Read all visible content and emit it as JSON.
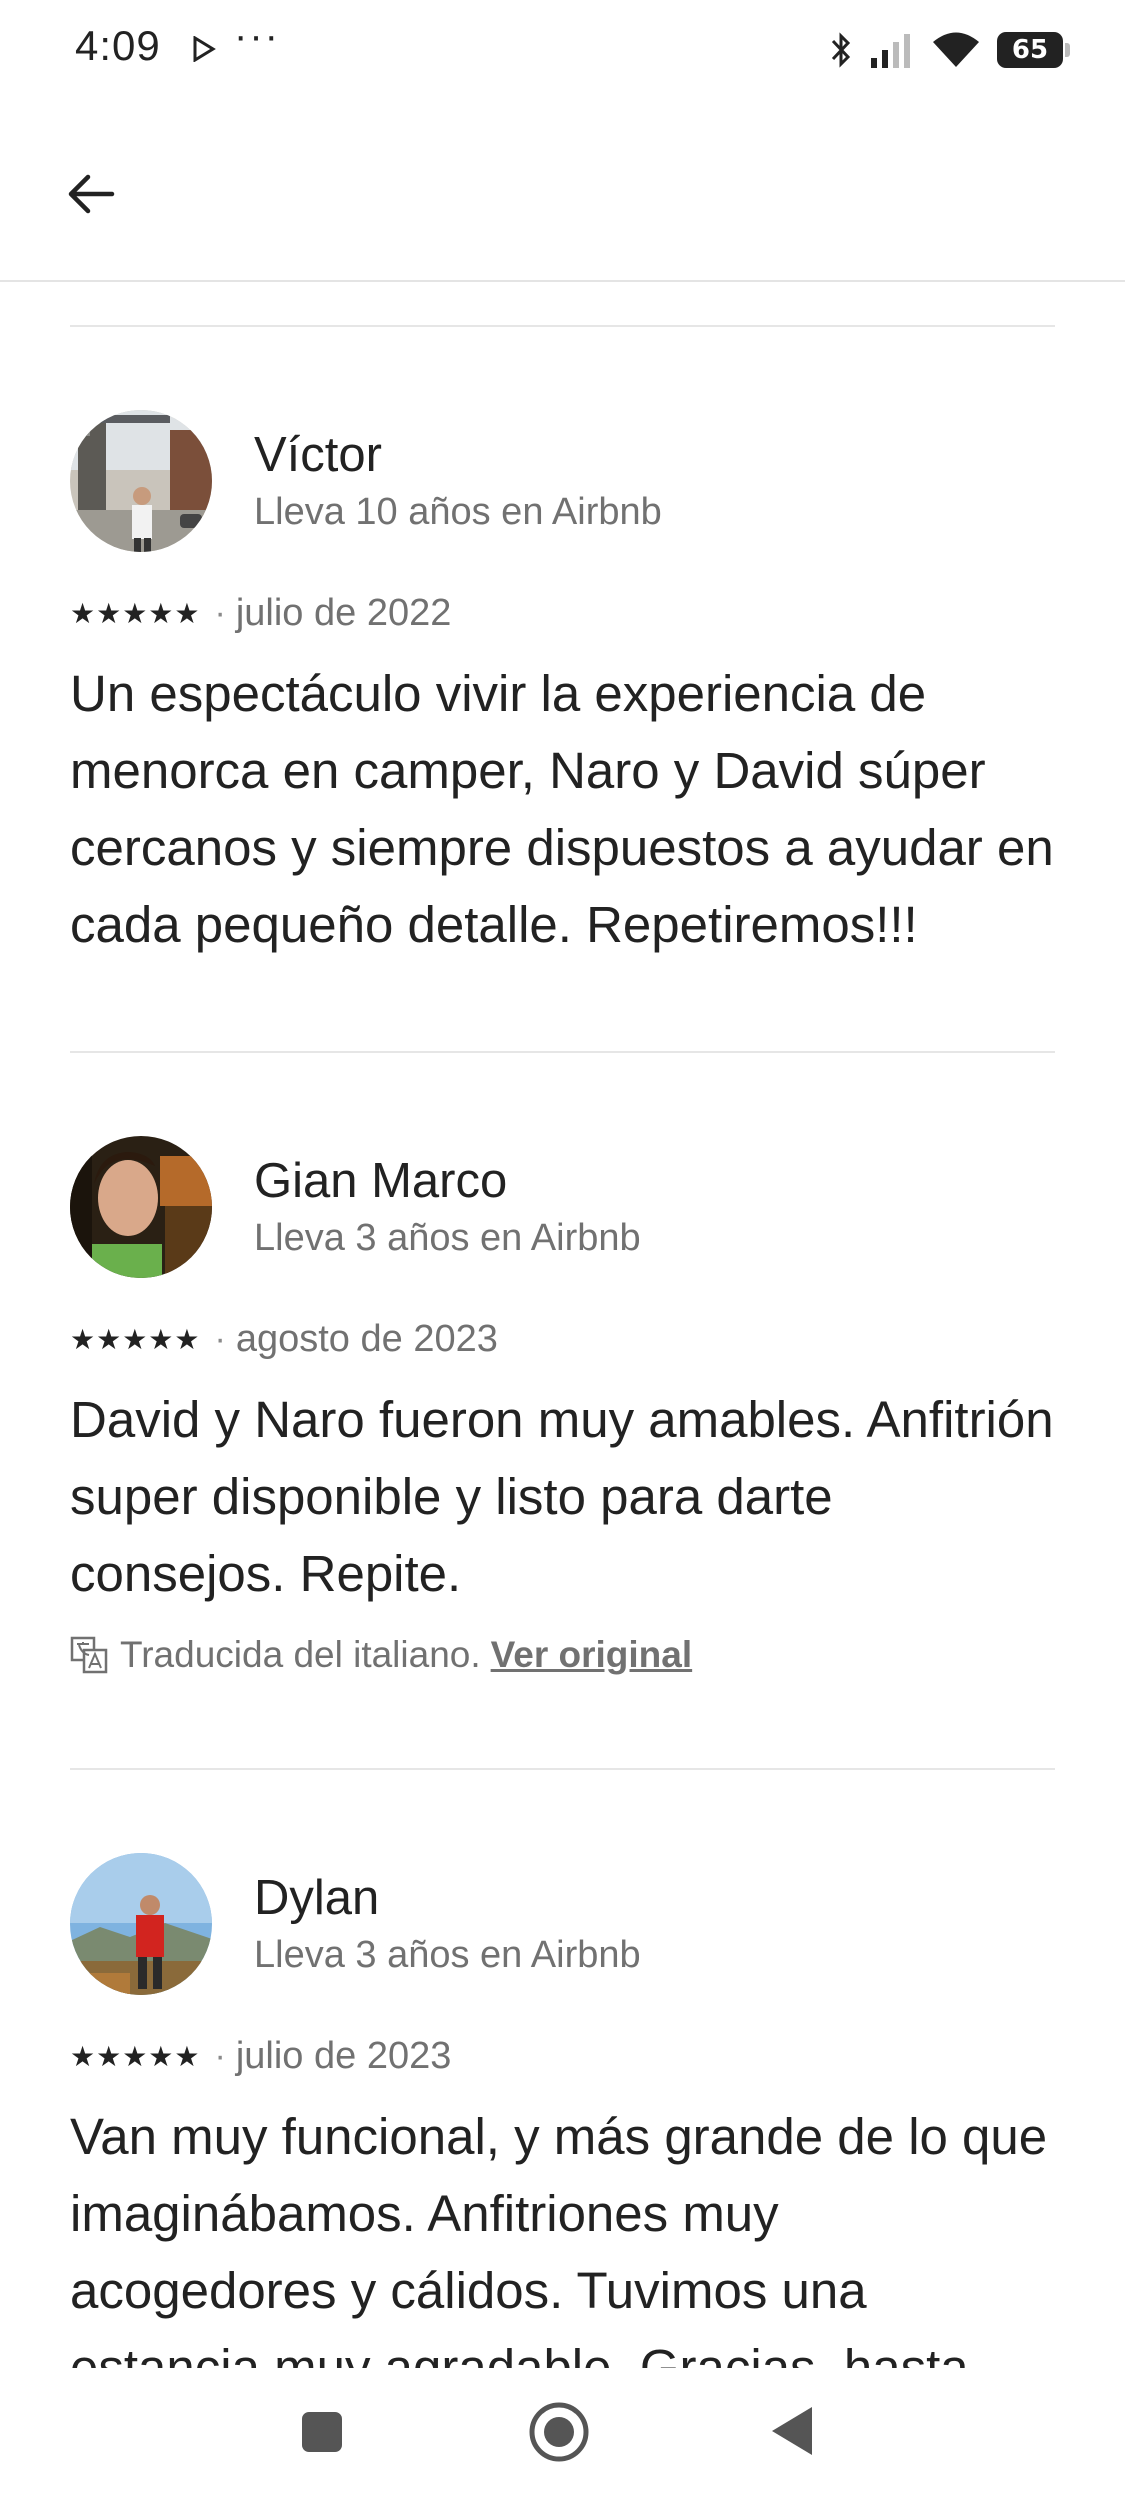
{
  "status_bar": {
    "time": "4:09",
    "more": "···",
    "battery": "65",
    "icons": [
      "play-icon",
      "bluetooth-icon",
      "signal-icon",
      "wifi-icon",
      "battery-icon"
    ]
  },
  "header": {
    "back_icon": "arrow-left-icon"
  },
  "reviews": [
    {
      "name": "Víctor",
      "tenure": "Lleva 10 años en Airbnb",
      "stars": "★★★★★",
      "rating": 5,
      "date": "julio de 2022",
      "text": "Un espectáculo vivir la experiencia de menorca en camper, Naro y David súper cercanos y siempre dispuestos a ayudar en cada pequeño detalle. Repetiremos!!!"
    },
    {
      "name": "Gian Marco",
      "tenure": "Lleva 3 años en Airbnb",
      "stars": "★★★★★",
      "rating": 5,
      "date": "agosto de 2023",
      "text": "David y Naro fueron muy amables. Anfitrión super disponible y listo para darte consejos. Repite.",
      "translation_note": "Traducida del italiano.",
      "original_link": "Ver original"
    },
    {
      "name": "Dylan",
      "tenure": "Lleva 3 años en Airbnb",
      "stars": "★★★★★",
      "rating": 5,
      "date": "julio de 2023",
      "text": "Van muy funcional, y más grande de lo que imaginábamos. Anfitriones muy acogedores y cálidos. Tuvimos una estancia muy agradable. Gracias, hasta"
    }
  ],
  "rating_separator": "·",
  "nav_bar": {
    "icons": [
      "recents-icon",
      "home-icon",
      "back-triangle-icon"
    ]
  },
  "colors": {
    "text": "#222222",
    "muted": "#717171",
    "divider": "#e6e6e6"
  }
}
